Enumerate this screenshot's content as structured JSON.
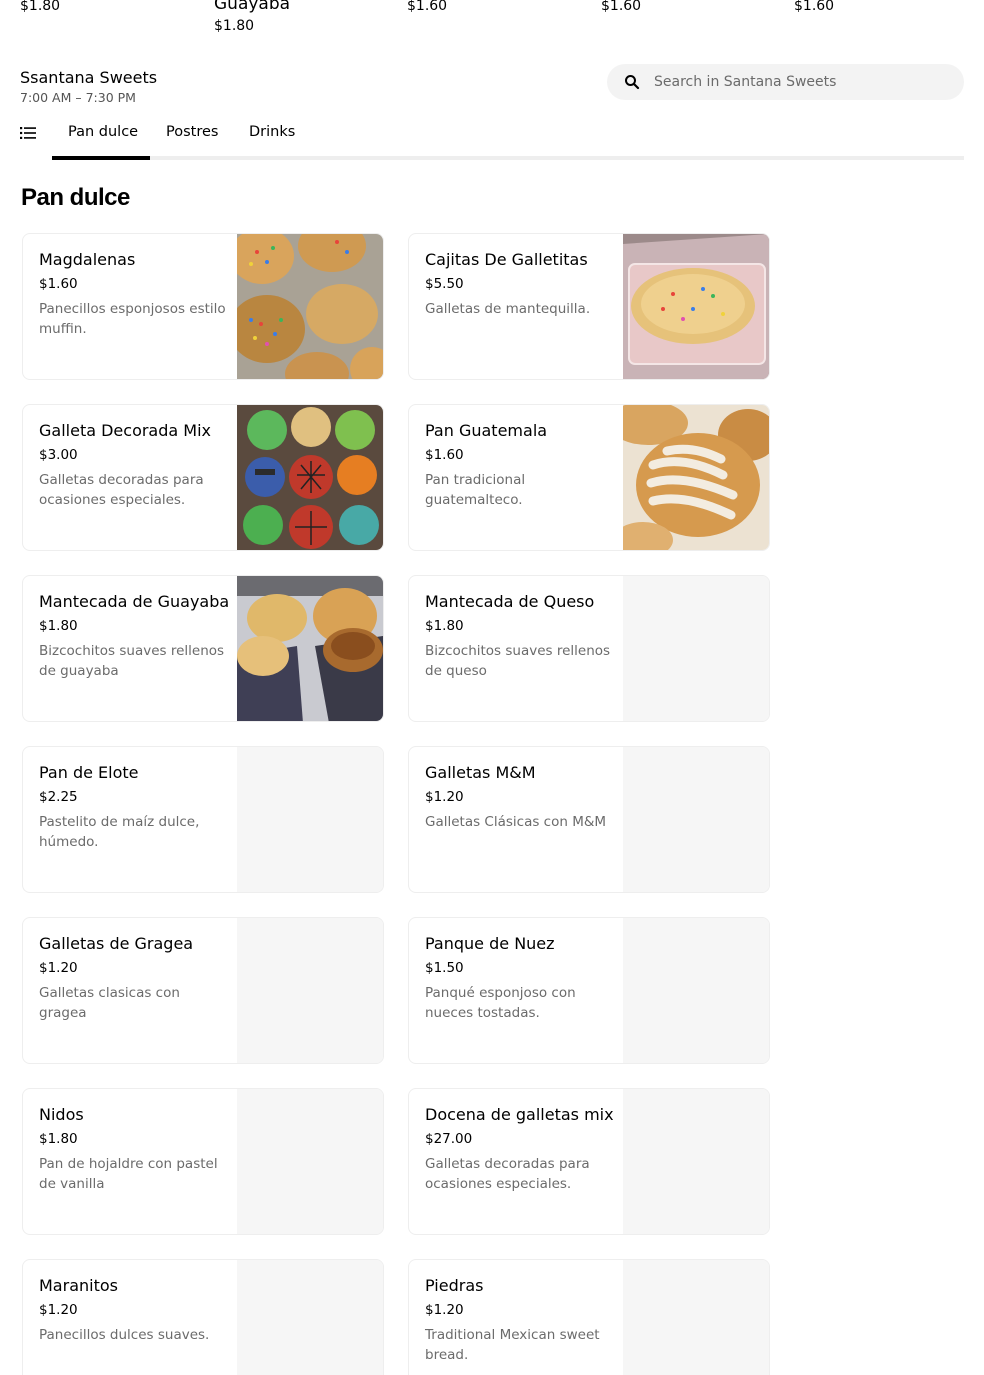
{
  "top_strip": {
    "items": [
      {
        "name": "",
        "price": "$1.80"
      },
      {
        "name": "Guayaba",
        "price": "$1.80"
      },
      {
        "name": "",
        "price": "$1.60"
      },
      {
        "name": "",
        "price": "$1.60"
      },
      {
        "name": "",
        "price": "$1.60"
      }
    ]
  },
  "store": {
    "name": "Ssantana Sweets",
    "hours": "7:00 AM – 7:30 PM"
  },
  "search": {
    "placeholder": "Search in Santana Sweets",
    "icon": "search-icon"
  },
  "nav": {
    "menu_icon": "list-icon",
    "tabs": [
      "Pan dulce",
      "Postres",
      "Drinks"
    ],
    "active_tab": "Pan dulce"
  },
  "section": {
    "title": "Pan dulce",
    "items": [
      {
        "title": "Magdalenas",
        "price": "$1.60",
        "desc": "Panecillos esponjosos estilo muffin.",
        "has_image": true
      },
      {
        "title": "Cajitas De Galletitas",
        "price": "$5.50",
        "desc": "Galletas de mantequilla.",
        "has_image": true
      },
      {
        "title": "Galleta Decorada Mix",
        "price": "$3.00",
        "desc": "Galletas decoradas para ocasiones especiales.",
        "has_image": true
      },
      {
        "title": "Pan Guatemala",
        "price": "$1.60",
        "desc": "Pan tradicional guatemalteco.",
        "has_image": true
      },
      {
        "title": "Mantecada de Guayaba",
        "price": "$1.80",
        "desc": "Bizcochitos suaves rellenos de guayaba",
        "has_image": true
      },
      {
        "title": "Mantecada de Queso",
        "price": "$1.80",
        "desc": "Bizcochitos suaves rellenos de queso",
        "has_image": false
      },
      {
        "title": "Pan de Elote",
        "price": "$2.25",
        "desc": "Pastelito de maíz dulce, húmedo.",
        "has_image": false
      },
      {
        "title": "Galletas M&M",
        "price": "$1.20",
        "desc": "Galletas Clásicas con M&M",
        "has_image": false
      },
      {
        "title": "Galletas de Gragea",
        "price": "$1.20",
        "desc": "Galletas clasicas con gragea",
        "has_image": false
      },
      {
        "title": "Panque de Nuez",
        "price": "$1.50",
        "desc": "Panqué esponjoso con nueces tostadas.",
        "has_image": false
      },
      {
        "title": "Nidos",
        "price": "$1.80",
        "desc": "Pan de hojaldre con pastel de vanilla",
        "has_image": false
      },
      {
        "title": "Docena de galletas mix",
        "price": "$27.00",
        "desc": "Galletas decoradas para ocasiones especiales.",
        "has_image": false
      },
      {
        "title": "Maranitos",
        "price": "$1.20",
        "desc": "Panecillos dulces suaves.",
        "has_image": false
      },
      {
        "title": "Piedras",
        "price": "$1.20",
        "desc": "Traditional Mexican sweet bread.",
        "has_image": false
      }
    ]
  }
}
